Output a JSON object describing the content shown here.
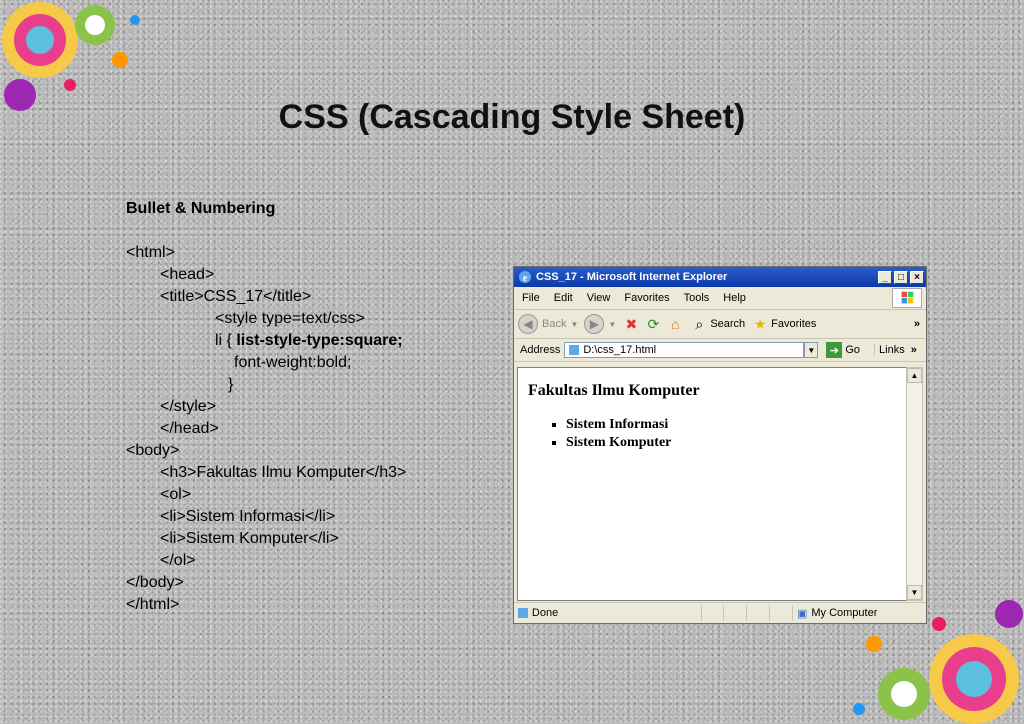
{
  "slide": {
    "title": "CSS (Cascading Style Sheet)",
    "heading": "Bullet & Numbering"
  },
  "code": {
    "l1": "<html>",
    "l2": "<head>",
    "l3": "<title>CSS_17</title>",
    "l4": "<style type=text/css>",
    "l5_prefix": "li { ",
    "l5_bold": "list-style-type:square;",
    "l6": "font-weight:bold;",
    "l7": "}",
    "l8": "</style>",
    "l9": "</head>",
    "l10": "<body>",
    "l11": "<h3>Fakultas Ilmu Komputer</h3>",
    "l12": "<ol>",
    "l13": "<li>Sistem Informasi</li>",
    "l14": "<li>Sistem Komputer</li>",
    "l15": "</ol>",
    "l16": "</body>",
    "l17": "</html>"
  },
  "browser": {
    "title": "CSS_17 - Microsoft Internet Explorer",
    "menu": [
      "File",
      "Edit",
      "View",
      "Favorites",
      "Tools",
      "Help"
    ],
    "toolbar": {
      "back": "Back",
      "search": "Search",
      "favorites": "Favorites"
    },
    "address_label": "Address",
    "address_value": "D:\\css_17.html",
    "go_label": "Go",
    "links_label": "Links",
    "page_heading": "Fakultas Ilmu Komputer",
    "page_items": [
      "Sistem Informasi",
      "Sistem Komputer"
    ],
    "status_text": "Done",
    "zone_text": "My Computer"
  }
}
